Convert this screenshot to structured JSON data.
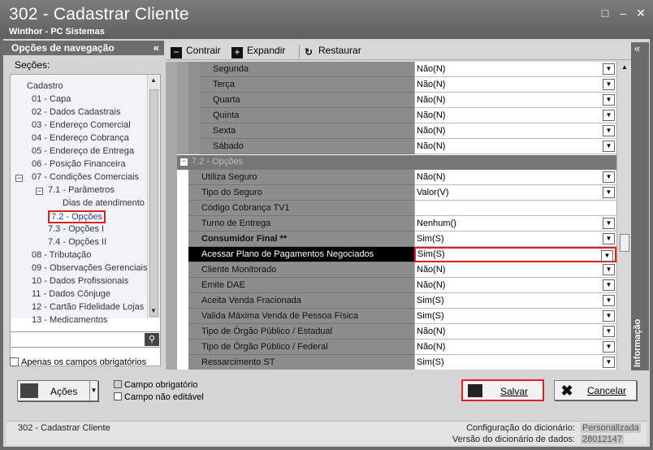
{
  "window": {
    "title": "302 - Cadastrar Cliente",
    "subtitle": "Winthor - PC Sistemas"
  },
  "nav": {
    "header": "Opções de navegação",
    "sections_label": "Seções:",
    "tree": [
      {
        "label": "Cadastro",
        "level": 0
      },
      {
        "label": "01 - Capa",
        "level": 1
      },
      {
        "label": "02 - Dados Cadastrais",
        "level": 1
      },
      {
        "label": "03 - Endereço Comercial",
        "level": 1
      },
      {
        "label": "04 - Endereço Cobrança",
        "level": 1
      },
      {
        "label": "05 - Endereço de Entrega",
        "level": 1
      },
      {
        "label": "06 - Posição Financeira",
        "level": 1
      },
      {
        "label": "07 - Condições Comerciais",
        "level": 1
      },
      {
        "label": "7.1 - Parâmetros",
        "level": 2
      },
      {
        "label": "Dias de atendimento",
        "level": 3
      },
      {
        "label": "7.2 - Opções",
        "level": 2,
        "selected": true
      },
      {
        "label": "7.3 - Opções I",
        "level": 2
      },
      {
        "label": "7.4 - Opções II",
        "level": 2
      },
      {
        "label": "08 - Tributação",
        "level": 1
      },
      {
        "label": "09 - Observações Gerenciais",
        "level": 1
      },
      {
        "label": "10 - Dados Profissionais",
        "level": 1
      },
      {
        "label": "11 - Dados Cônjuge",
        "level": 1
      },
      {
        "label": "12 - Cartão Fidelidade Lojas",
        "level": 1
      },
      {
        "label": "13 - Medicamentos",
        "level": 1
      }
    ],
    "required_only_label": "Apenas os campos obrigatórios"
  },
  "toolbar": {
    "contrair": "Contrair",
    "expandir": "Expandir",
    "restaurar": "Restaurar"
  },
  "grid": {
    "top_rows": [
      {
        "label": "Segunda",
        "value": "Não(N)"
      },
      {
        "label": "Terça",
        "value": "Não(N)"
      },
      {
        "label": "Quarta",
        "value": "Não(N)"
      },
      {
        "label": "Quinta",
        "value": "Não(N)"
      },
      {
        "label": "Sexta",
        "value": "Não(N)"
      },
      {
        "label": "Sábado",
        "value": "Não(N)"
      }
    ],
    "section_title": "7.2 - Opções",
    "rows": [
      {
        "label": "Utiliza Seguro",
        "value": "Não(N)",
        "dropdown": true
      },
      {
        "label": "Tipo do Seguro",
        "value": "Valor(V)",
        "dropdown": true
      },
      {
        "label": "Código Cobrança TV1",
        "value": "",
        "dropdown": false
      },
      {
        "label": "Turno de Entrega",
        "value": "Nenhum()",
        "dropdown": true
      },
      {
        "label": "Consumidor Final **",
        "value": "Sim(S)",
        "dropdown": true,
        "bold": true
      },
      {
        "label": "Acessar Plano de Pagamentos Negociados",
        "value": "Sim(S)",
        "dropdown": true,
        "highlight": true
      },
      {
        "label": "Cliente Monitorado",
        "value": "Não(N)",
        "dropdown": true
      },
      {
        "label": "Emite DAE",
        "value": "Não(N)",
        "dropdown": true
      },
      {
        "label": "Aceita Venda Fracionada",
        "value": "Sim(S)",
        "dropdown": true
      },
      {
        "label": "Valida Máxima Venda de Pessoa Física",
        "value": "Sim(S)",
        "dropdown": true
      },
      {
        "label": "Tipo de Órgão Público / Estadual",
        "value": "Não(N)",
        "dropdown": true
      },
      {
        "label": "Tipo de Órgão Público / Federal",
        "value": "Não(N)",
        "dropdown": true
      },
      {
        "label": "Ressarcimento ST",
        "value": "Sim(S)",
        "dropdown": true
      }
    ]
  },
  "info_panel_label": "Informação",
  "footer": {
    "acoes": "Ações",
    "campo_obrigatorio": "Campo obrigatório",
    "campo_nao_editavel": "Campo não editável",
    "salvar": "Salvar",
    "cancelar": "Cancelar"
  },
  "statusbar": {
    "left": "302 - Cadastrar Cliente",
    "config_label": "Configuração do dicionário:",
    "config_value": "Personalizada",
    "version_label": "Versão do dicionário de dados:",
    "version_value": "28012147"
  },
  "colors": {
    "highlight_border": "#e02020",
    "title_bg": "#6a6a6a",
    "grid_label_bg": "#8d8d8d"
  }
}
